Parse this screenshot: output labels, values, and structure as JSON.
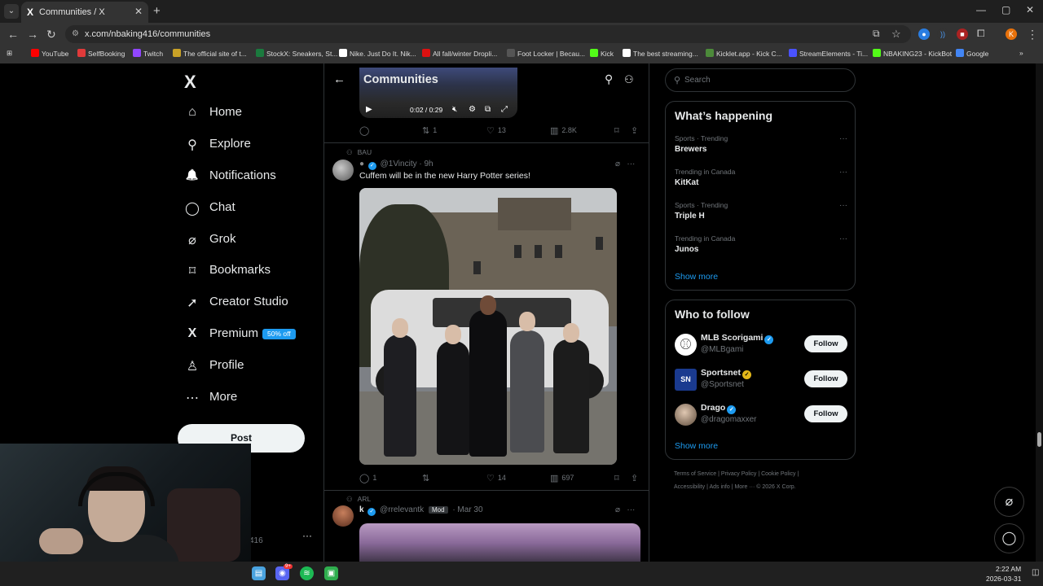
{
  "browser": {
    "tab_title": "Communities / X",
    "tab_icon": "X",
    "url": "x.com/nbaking416/communities",
    "bookmarks": [
      {
        "label": "YouTube",
        "color": "#ff0000"
      },
      {
        "label": "SelfBooking",
        "color": "#e03a3a"
      },
      {
        "label": "Twitch",
        "color": "#9146ff"
      },
      {
        "label": "The official site of t...",
        "color": "#c9a227"
      },
      {
        "label": "StockX: Sneakers, St...",
        "color": "#1b7a3e"
      },
      {
        "label": "Nike. Just Do It. Nik...",
        "color": "#ffffff"
      },
      {
        "label": "All fall/winter Dropli...",
        "color": "#d11"
      },
      {
        "label": "Foot Locker | Becau...",
        "color": "#555"
      },
      {
        "label": "Kick",
        "color": "#53fc18"
      },
      {
        "label": "The best streaming...",
        "color": "#fff"
      },
      {
        "label": "Kicklet.app - Kick C...",
        "color": "#4c8a3a"
      },
      {
        "label": "StreamElements - Ti...",
        "color": "#4a52ff"
      },
      {
        "label": "NBAKING23 - KickBot",
        "color": "#53fc18"
      },
      {
        "label": "Google",
        "color": "#4285f4"
      }
    ],
    "profile_initial": "K"
  },
  "left_nav": {
    "logo": "X",
    "items": [
      {
        "label": "Home",
        "icon": "⌂"
      },
      {
        "label": "Explore",
        "icon": "⚲"
      },
      {
        "label": "Notifications",
        "icon": "🔔"
      },
      {
        "label": "Chat",
        "icon": "◯"
      },
      {
        "label": "Grok",
        "icon": "⌀"
      },
      {
        "label": "Bookmarks",
        "icon": "⌑"
      },
      {
        "label": "Creator Studio",
        "icon": "➚"
      },
      {
        "label": "Premium",
        "icon": "X"
      },
      {
        "label": "Profile",
        "icon": "♙"
      },
      {
        "label": "More",
        "icon": "⋯"
      }
    ],
    "premium_badge": "50% off",
    "post_label": "Post",
    "account_tail": "416"
  },
  "center": {
    "title": "Communities",
    "video": {
      "time": "0:02 / 0:29"
    },
    "prev_actions": {
      "replies": "",
      "reposts": "1",
      "likes": "13",
      "views": "2.8K"
    },
    "tweet1": {
      "community": "BAU",
      "name": "",
      "handle": "@1Vincity",
      "time": "· 9h",
      "text": "Cuffem will be in the new Harry Potter series!",
      "actions": {
        "replies": "1",
        "reposts": "",
        "likes": "14",
        "views": "697"
      }
    },
    "tweet2": {
      "community": "ARL",
      "name": "k",
      "handle": "@rrelevantk",
      "mod": "Mod",
      "time": "· Mar 30"
    }
  },
  "right": {
    "search_placeholder": "Search",
    "whats_happening": {
      "title": "What’s happening",
      "trends": [
        {
          "context": "Sports · Trending",
          "name": "Brewers"
        },
        {
          "context": "Trending in Canada",
          "name": "KitKat"
        },
        {
          "context": "Sports · Trending",
          "name": "Triple H"
        },
        {
          "context": "Trending in Canada",
          "name": "Junos"
        }
      ],
      "show_more": "Show more"
    },
    "who_to_follow": {
      "title": "Who to follow",
      "accounts": [
        {
          "name": "MLB Scorigami",
          "handle": "@MLBgami",
          "badge": "blue",
          "avatar_color": "#ffffff",
          "button": "Follow"
        },
        {
          "name": "Sportsnet",
          "handle": "@Sportsnet",
          "badge": "gold",
          "avatar_color": "#1a3a8f",
          "button": "Follow"
        },
        {
          "name": "Drago",
          "handle": "@dragomaxxer",
          "badge": "blue",
          "avatar_color": "#c9b4a0",
          "button": "Follow"
        }
      ],
      "show_more": "Show more"
    },
    "footer_line1": "Terms of Service  |  Privacy Policy  |  Cookie Policy  |",
    "footer_line2": "Accessibility  |  Ads info  |  More ···  © 2026 X Corp."
  },
  "taskbar": {
    "time": "2:22 AM",
    "date": "2026-03-31",
    "discord_badge": "9+"
  }
}
